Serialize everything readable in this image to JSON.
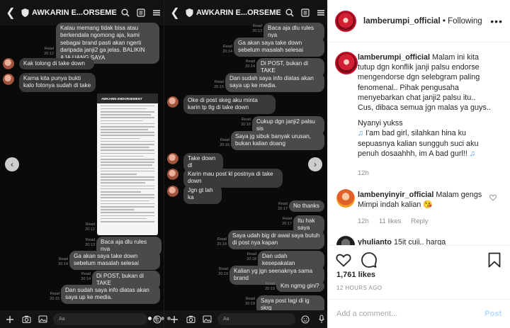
{
  "chat": {
    "title": "AWKARIN E...ORSEMENT",
    "input_placeholder": "Aa",
    "read_label": "Read",
    "left": {
      "messages": [
        {
          "dir": "out",
          "text": "Kalau memang tidak bisa atau berkendala ngomong aja, kami sebagai brand pasti akan ngerti daripada janji2 ga jelas. BALIKIN AJA UANG SAYA",
          "time": "Read 20:12"
        },
        {
          "dir": "in",
          "text": "Kak tolong di take down",
          "time": ""
        },
        {
          "dir": "in",
          "text": "Karna kita punya bukti kalo fotonya sudah di take",
          "time": ""
        },
        {
          "dir": "out",
          "text": "Baca aja dlu rules nya",
          "time": "Read 20:13"
        },
        {
          "dir": "out",
          "text": "Ga akan saya take down sebelum masalah selesai",
          "time": "Read 20:14"
        },
        {
          "dir": "out",
          "text": "Di POST, bukan di TAKE",
          "time": "Read 20:14"
        },
        {
          "dir": "out",
          "text": "Dan sudah saya info diatas akan saya up ke media.",
          "time": "Read 20:15"
        }
      ],
      "shot_title": "AWKARIN ENDORSEMENT"
    },
    "right": {
      "messages": [
        {
          "dir": "out",
          "text": "Baca aja dlu rules nya",
          "time": "Read 20:13"
        },
        {
          "dir": "out",
          "text": "Ga akan saya take down sebelum masalah selesai",
          "time": "Read 20:14"
        },
        {
          "dir": "out",
          "text": "Di POST, bukan di TAKE",
          "time": "Read 20:14"
        },
        {
          "dir": "out",
          "text": "Dan sudah saya info diatas akan saya up ke media.",
          "time": "Read 20:15"
        },
        {
          "dir": "in",
          "text": "Oke di post skeg aku minta karin tp tlg di take down",
          "time": ""
        },
        {
          "dir": "out",
          "text": "Cukup dgn janji2 palsu sis",
          "time": "Read 20:16"
        },
        {
          "dir": "out",
          "text": "Saya jg sibuk banyak urusan, bukan kalian doang",
          "time": "Read 20:16"
        },
        {
          "dir": "in",
          "text": "Take down dl",
          "time": ""
        },
        {
          "dir": "in",
          "text": "Karin mau post kl postnya di take down",
          "time": ""
        },
        {
          "dir": "in",
          "text": "Jgn gt lah ka",
          "time": ""
        },
        {
          "dir": "out",
          "text": "No thanks",
          "time": "Read 20:17"
        },
        {
          "dir": "out",
          "text": "Itu hak saya",
          "time": "Read 20:17"
        },
        {
          "dir": "out",
          "text": "Saya udah big dr awal saya butuh di post nya kapan",
          "time": "Read 20:18"
        },
        {
          "dir": "out",
          "text": "Dan udah kesepakatan",
          "time": "Read 20:18"
        },
        {
          "dir": "out",
          "text": "Kalian yg jgn seenaknya sama brand",
          "time": "Read 20:19"
        },
        {
          "dir": "out",
          "text": "Km ngmg gini?",
          "time": "Read 20:19"
        },
        {
          "dir": "out",
          "text": "Saya post lagi di ig skrg",
          "time": "Read 20:19"
        }
      ]
    }
  },
  "post": {
    "username": "lamberumpi_official",
    "separator": "•",
    "follow_label": "Following",
    "more_label": "•••",
    "caption_user": "lamberumpi_official",
    "caption_lines": [
      "Malam ini kita tutup dgn konflik janji palsu endorse mengendorse dgn selebgram paling fenomenal.. Pihak pengusaha menyebarkan chat janji2 palsu itu.. Cus, dibaca semua jgn malas ya guys..",
      "Nyanyi yukss",
      "I'am bad girl, silahkan hina ku sepuasnya kalian sungguh suci aku penuh dosaahhh, im A bad gurl!!"
    ],
    "caption_time": "12h",
    "comments": [
      {
        "user": "lambenyinyir_official",
        "text": "Malam gengs Mimpi indah kalian 😘",
        "time": "12h",
        "likes": "11 likes",
        "reply": "Reply"
      },
      {
        "user": "yhulianto",
        "text": "15it cuii.. harga",
        "time": "",
        "likes": "",
        "reply": ""
      }
    ],
    "likes_count": "1,761 likes",
    "time_ago": "12 HOURS AGO",
    "add_comment_placeholder": "Add a comment...",
    "post_label": "Post",
    "accent": "#3897f0"
  }
}
